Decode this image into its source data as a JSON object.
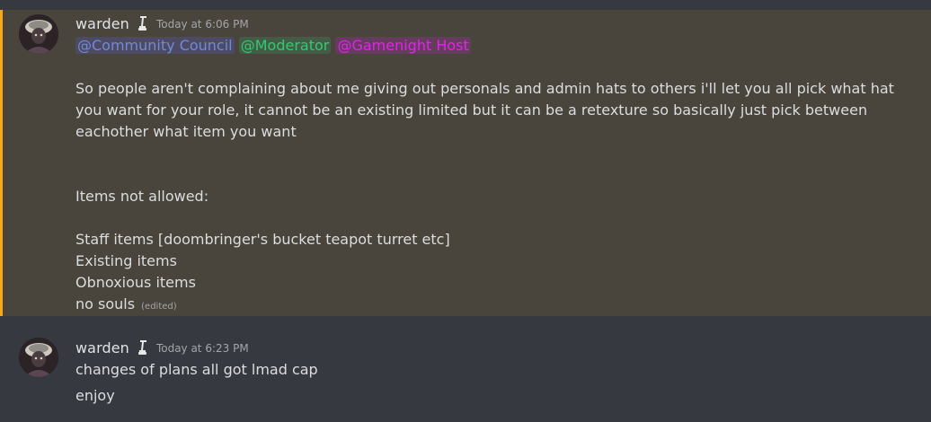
{
  "colors": {
    "background": "#36393f",
    "highlight_background": "#49443c",
    "highlight_bar": "#faa81a",
    "mention_community_council": "#7289da",
    "mention_moderator": "#2ecc71",
    "mention_gamenight_host": "#e91ef2",
    "timestamp": "#a3a6aa"
  },
  "messages": [
    {
      "author": "warden",
      "badge_icon": "staff-badge-icon",
      "timestamp": "Today at 6:06 PM",
      "highlighted": true,
      "mentions": [
        "@Community Council",
        "@Moderator",
        "@Gamenight Host"
      ],
      "body": "So people aren't complaining about me giving out personals and admin hats to others i'll let you all pick what hat you want for your role, it cannot be an existing limited but it can be a retexture so basically just pick between eachother what item you want",
      "list_heading": "Items not allowed:",
      "list_items": [
        "Staff items [doombringer's bucket teapot turret etc]",
        "Existing items",
        "Obnoxious items",
        "no souls"
      ],
      "edited_label": "(edited)"
    },
    {
      "author": "warden",
      "badge_icon": "staff-badge-icon",
      "timestamp": "Today at 6:23 PM",
      "highlighted": false,
      "lines": [
        "changes of plans all got lmad cap",
        "enjoy"
      ]
    }
  ]
}
